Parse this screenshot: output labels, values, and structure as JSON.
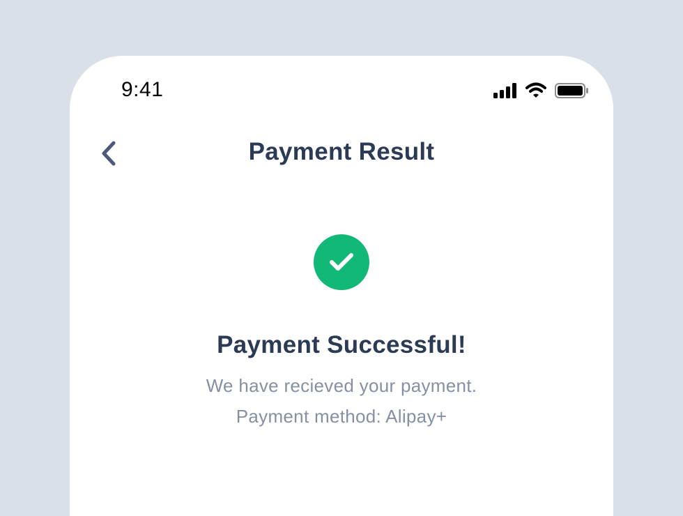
{
  "status_bar": {
    "time": "9:41",
    "icons": [
      "signal-icon",
      "wifi-icon",
      "battery-icon"
    ]
  },
  "header": {
    "back_icon": "chevron-left-icon",
    "title": "Payment Result"
  },
  "result": {
    "icon": "check-circle-icon",
    "icon_color": "#12b877",
    "title": "Payment Successful!",
    "message": "We have recieved your payment.",
    "method_text": "Payment method: Alipay+"
  },
  "colors": {
    "background": "#d9e0e7",
    "card": "#ffffff",
    "title_text": "#2b3a55",
    "secondary_text": "#8590a3",
    "success": "#12b877"
  }
}
